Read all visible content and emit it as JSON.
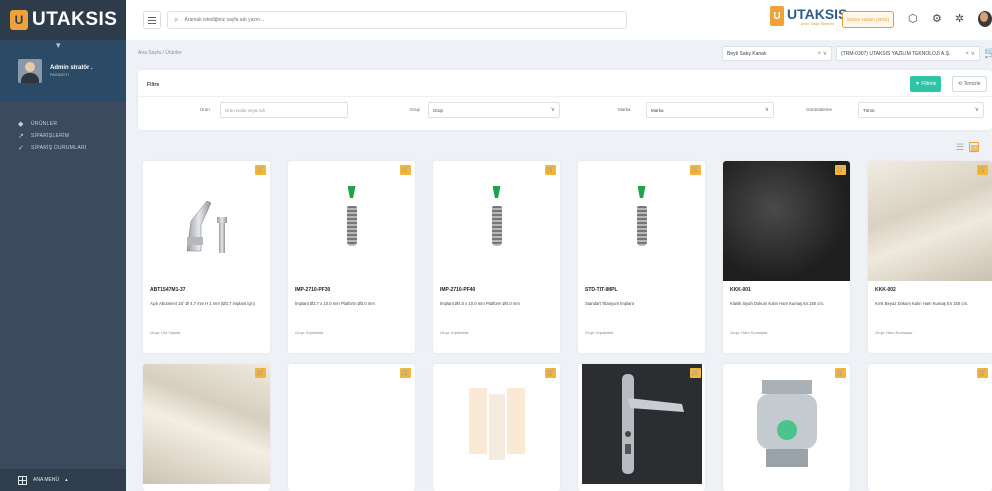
{
  "sidebar": {
    "logo": "UTAKSIS",
    "user": {
      "name": "Admin stratör .",
      "role": "PASSAYTI"
    },
    "items": [
      {
        "label": "ÜRÜNLER",
        "icon": "tag-icon"
      },
      {
        "label": "SİPARİŞLERİM",
        "icon": "trend-icon"
      },
      {
        "label": "SİPARİŞ DURUMLARI",
        "icon": "check-icon"
      }
    ],
    "footer": "ANA MENÜ"
  },
  "topbar": {
    "search_placeholder": "Aramak istediğiniz sayfa adı yazın...",
    "brand": "UTAKSIS",
    "brand_sub": "Ürün Takip Sistemi",
    "version_button": "Sürüm Notları (2024)"
  },
  "content": {
    "breadcrumb": "Ana Sayfa  /  Ürünler",
    "company_select": "Beyti Satış Kanalı",
    "company_select2": "(TRM-0307) UTAKSIS YAZILIM TEKNOLOJİ A.Ş.",
    "filter": {
      "title": "Filtre",
      "filter_button": "Filtrele",
      "clear_button": "Temizle",
      "fields": [
        {
          "label": "Ürün",
          "placeholder": "Ürün Kodu veya Adı"
        },
        {
          "label": "Grup",
          "value": "Grup"
        },
        {
          "label": "Marka",
          "value": "Marka"
        },
        {
          "label": "Görüntüleme",
          "value": "Tümü"
        }
      ]
    }
  },
  "products": [
    {
      "code": "ABT1547M1-37",
      "desc": "Açılı Abutment 15° Ø 4.7 mm H 1 mm (Ø3.7 implant için)",
      "group": "Grup: Üst Yapılar",
      "image": "abutment"
    },
    {
      "code": "IMP-2710-PF30",
      "desc": "İmplant Ø3.7 x 10.0 mm Platform Ø3.0 mm",
      "group": "Grup: İmplantlar",
      "image": "implant"
    },
    {
      "code": "IMP-2710-PF40",
      "desc": "İmplant Ø4.0 x 10.0 mm Platform Ø4.0 mm",
      "group": "Grup: İmplantlar",
      "image": "implant"
    },
    {
      "code": "STD-TIT-IMPL",
      "desc": "Standart Titanyum İmplant",
      "group": "Grup: İmplantlar",
      "image": "implant"
    },
    {
      "code": "KKK-001",
      "desc": "Klasik Siyah Dokum Kalın Ham Kumaş 64.150 cm.",
      "group": "Grup: Ham Kumaşlar",
      "image": "fabric-dark"
    },
    {
      "code": "KKK-002",
      "desc": "Kırık Beyaz Dokum Kalın Ham Kumaş En 150 cm.",
      "group": "Grup: Ham Kumaşlar",
      "image": "fabric-light"
    },
    {
      "code": "",
      "desc": "",
      "group": "",
      "image": "fabric-light2"
    },
    {
      "code": "",
      "desc": "",
      "group": "",
      "image": "empty"
    },
    {
      "code": "",
      "desc": "",
      "group": "",
      "image": "watermark"
    },
    {
      "code": "",
      "desc": "",
      "group": "",
      "image": "handle"
    },
    {
      "code": "",
      "desc": "",
      "group": "",
      "image": "camera"
    },
    {
      "code": "",
      "desc": "",
      "group": "",
      "image": "empty"
    }
  ],
  "colors": {
    "accent": "#f0a23a",
    "sidebar": "#3b4a5c",
    "filter_button": "#2ec4a5",
    "brand": "#2f5d8a"
  }
}
